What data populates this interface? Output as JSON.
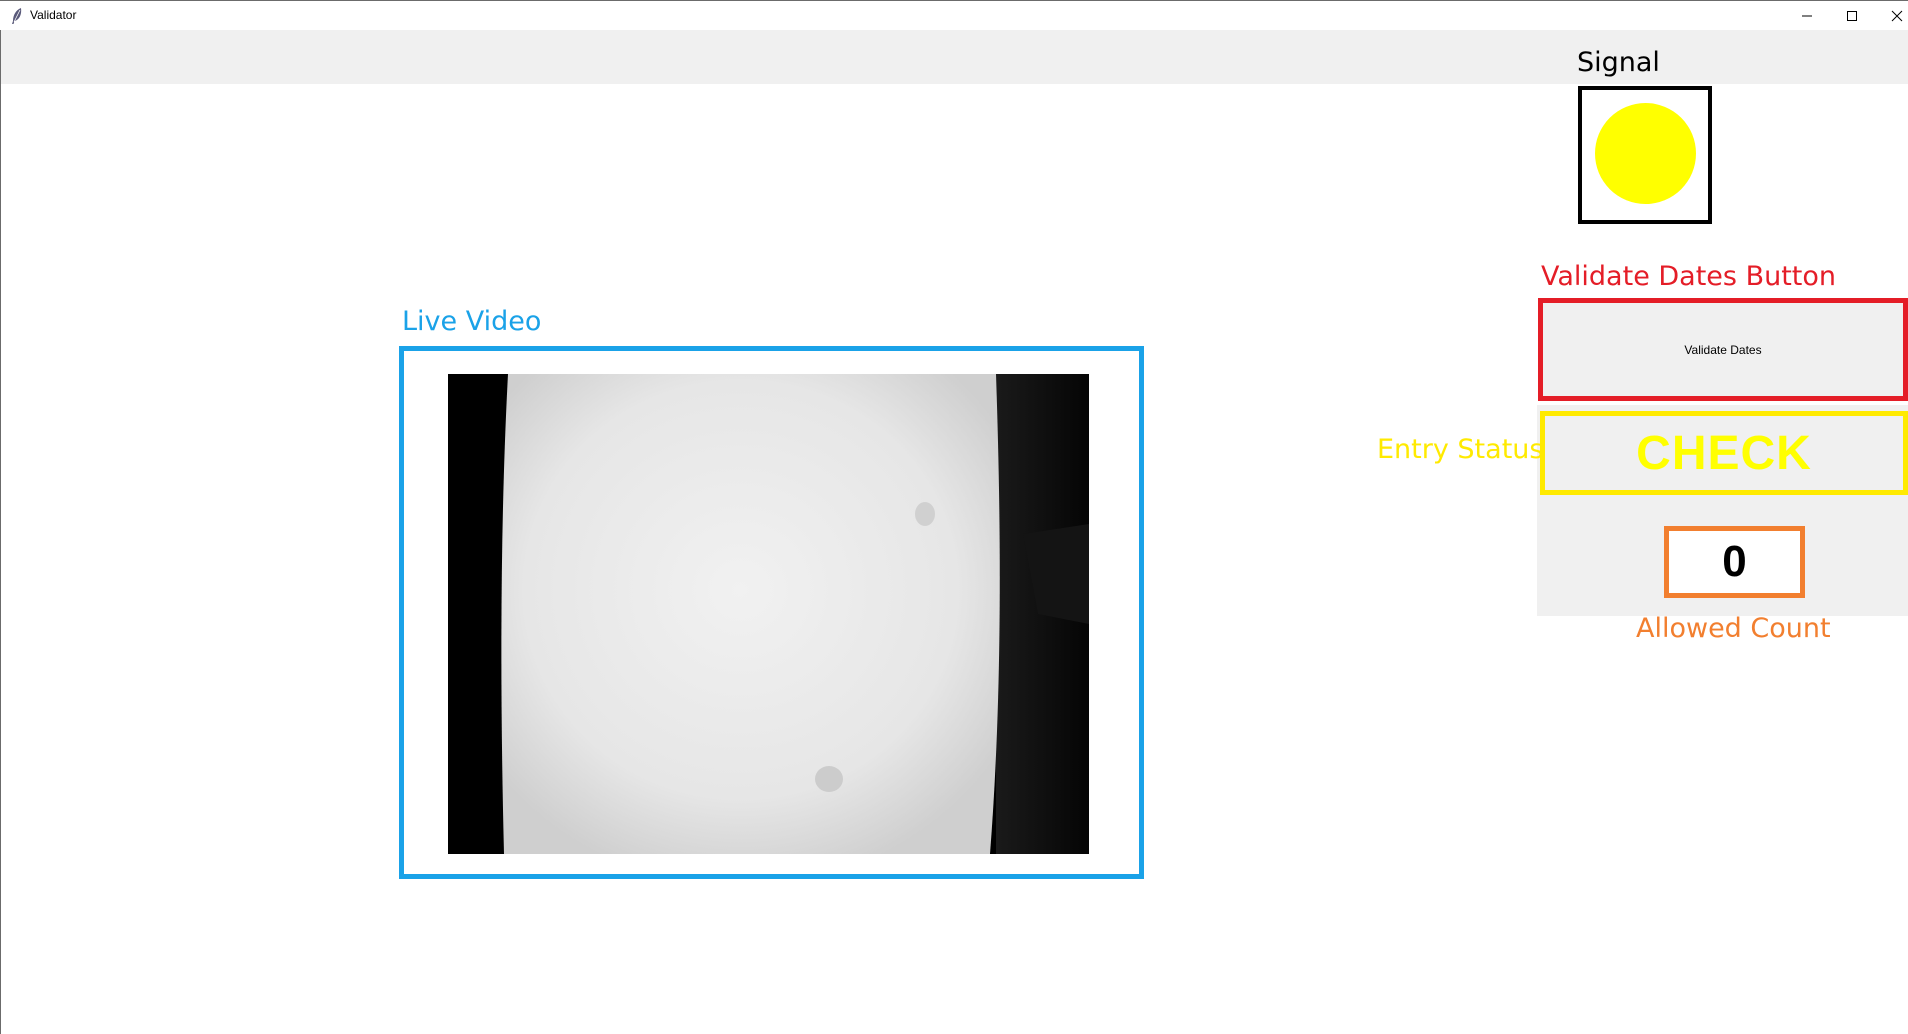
{
  "window": {
    "title": "Validator",
    "minimize_glyph": "—",
    "maximize_glyph": "☐",
    "close_glyph": "✕"
  },
  "signal": {
    "label": "Signal",
    "light_color": "#ffff00"
  },
  "validate": {
    "label": "Validate Dates Button",
    "button_text": "Validate Dates",
    "accent_color": "#e41d27"
  },
  "entry_status": {
    "label": "Entry Status",
    "value": "CHECK",
    "accent_color": "#ffea00"
  },
  "allowed_count": {
    "label": "Allowed Count",
    "value": "0",
    "accent_color": "#f27f2f"
  },
  "live_video": {
    "label": "Live Video",
    "accent_color": "#1aa2e8"
  },
  "icons": {
    "app": "feather-icon",
    "minimize": "minimize-icon",
    "maximize": "maximize-icon",
    "close": "close-icon"
  }
}
